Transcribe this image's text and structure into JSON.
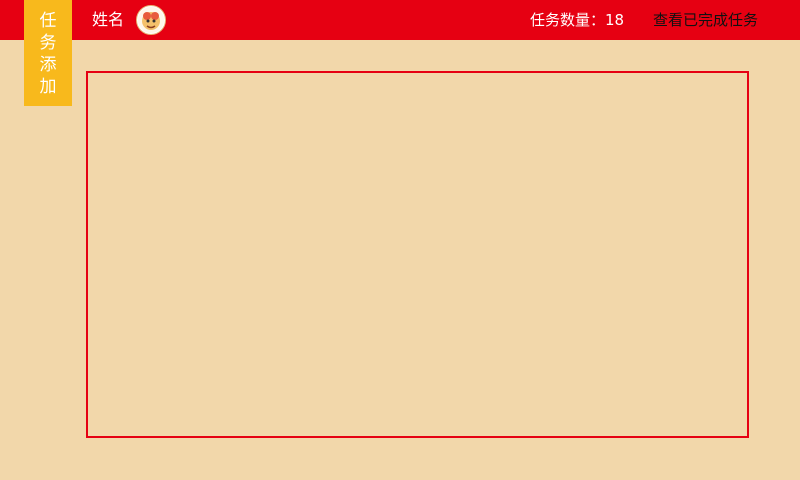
{
  "header": {
    "username": "姓名",
    "task_count": "任务数量：18",
    "view_completed_label": "查看已完成任务"
  },
  "sidebar": {
    "add_task_label": "任务添加"
  },
  "colors": {
    "background": "#f2d7aa",
    "header": "#e60012",
    "add_task_tab": "#f8b91c",
    "panel_border": "#e60012"
  },
  "icons": {
    "avatar": "cartoon-avatar-icon"
  }
}
